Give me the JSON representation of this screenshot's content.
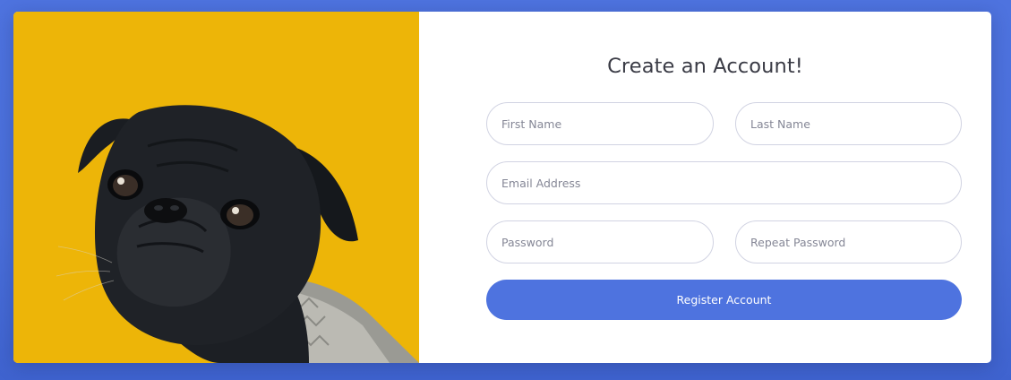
{
  "form": {
    "title": "Create an Account!",
    "first_name": {
      "placeholder": "First Name",
      "value": ""
    },
    "last_name": {
      "placeholder": "Last Name",
      "value": ""
    },
    "email": {
      "placeholder": "Email Address",
      "value": ""
    },
    "password": {
      "placeholder": "Password",
      "value": ""
    },
    "repeat_password": {
      "placeholder": "Repeat Password",
      "value": ""
    },
    "register_label": "Register Account"
  },
  "image": {
    "subject": "pug-dog-photo"
  },
  "colors": {
    "background": "#4e73df",
    "image_panel": "#edb508",
    "button": "#4e73df",
    "title_text": "#3a3b45",
    "input_border": "#d1d3e2"
  }
}
